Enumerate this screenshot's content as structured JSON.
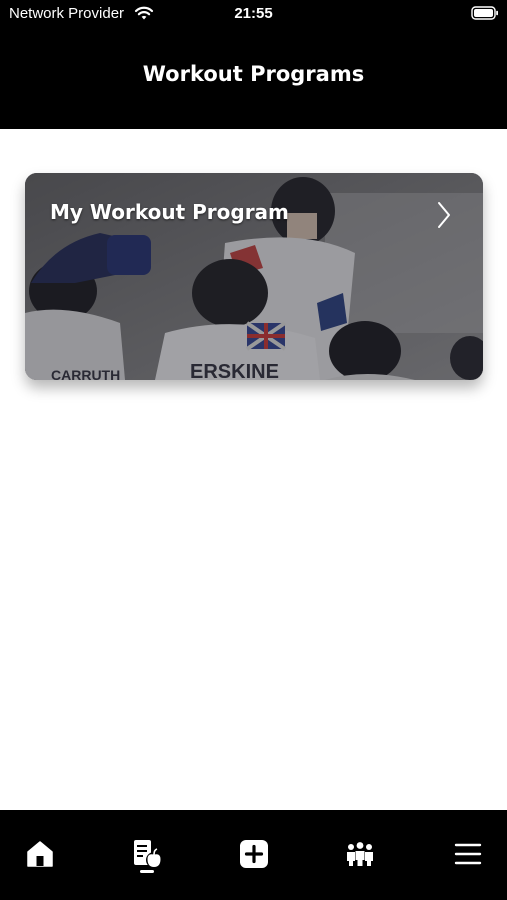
{
  "status_bar": {
    "carrier": "Network Provider",
    "time": "21:55",
    "wifi_icon": "wifi-icon",
    "battery_icon": "battery-icon"
  },
  "header": {
    "title": "Workout Programs"
  },
  "programs": [
    {
      "title": "My Workout Program",
      "image": "ice-hockey-team-photo",
      "chevron_icon": "chevron-right-icon"
    }
  ],
  "tab_bar": {
    "items": [
      {
        "icon": "home-icon",
        "active": false
      },
      {
        "icon": "nutrition-workout-icon",
        "active": true
      },
      {
        "icon": "add-square-icon",
        "active": false
      },
      {
        "icon": "team-icon",
        "active": false
      },
      {
        "icon": "menu-icon",
        "active": false
      }
    ]
  },
  "colors": {
    "header_bg": "#000000",
    "tab_bar_bg": "#000000",
    "page_bg": "#ffffff",
    "text_on_dark": "#ffffff"
  }
}
